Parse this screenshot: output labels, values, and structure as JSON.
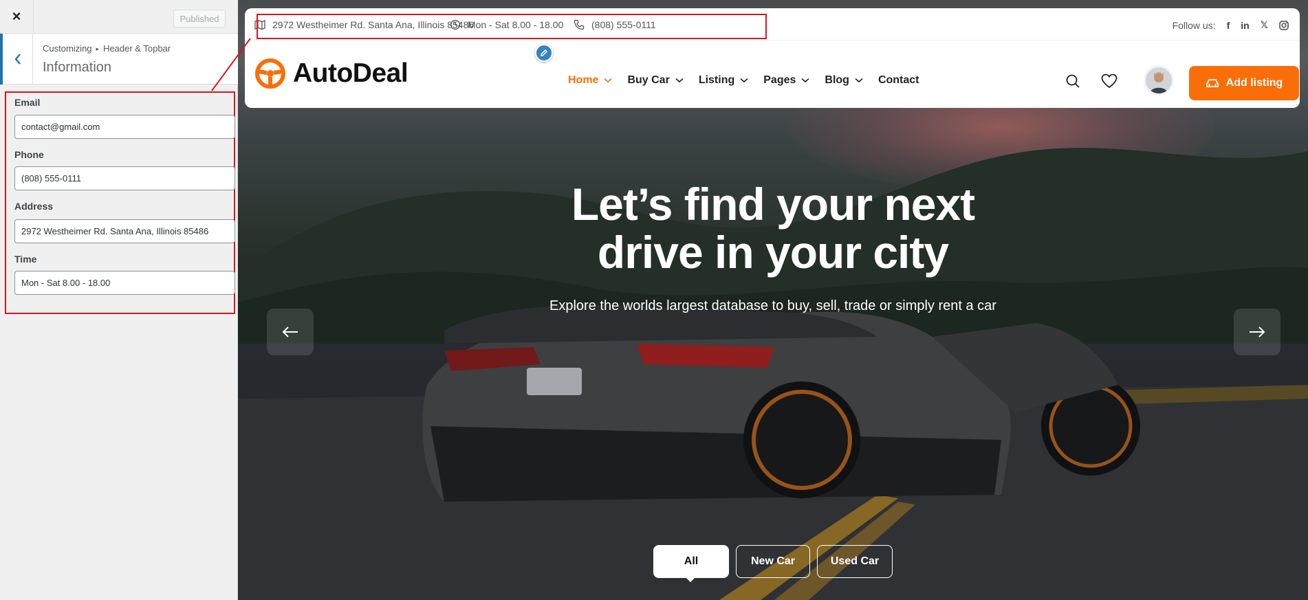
{
  "customizer": {
    "close_label": "×",
    "publish_label": "Published",
    "breadcrumb_root": "Customizing",
    "breadcrumb_sep": "▸",
    "breadcrumb_section": "Header & Topbar",
    "section_title": "Information",
    "fields": {
      "email": {
        "label": "Email",
        "value": "contact@gmail.com"
      },
      "phone": {
        "label": "Phone",
        "value": "(808) 555-0111"
      },
      "address": {
        "label": "Address",
        "value": "2972 Westheimer Rd. Santa Ana, Illinois 85486"
      },
      "time": {
        "label": "Time",
        "value": "Mon - Sat 8.00 - 18.00"
      }
    }
  },
  "site": {
    "topbar": {
      "address": "2972 Westheimer Rd. Santa Ana, Illinois 85486",
      "hours": "Mon - Sat 8.00 - 18.00",
      "phone": "(808) 555-0111",
      "follow_label": "Follow us:",
      "social": {
        "facebook": "f",
        "linkedin": "in",
        "x": "𝕏"
      }
    },
    "logo_text": "AutoDeal",
    "nav": [
      "Home",
      "Buy Car",
      "Listing",
      "Pages",
      "Blog",
      "Contact"
    ],
    "add_listing_label": "Add listing",
    "hero": {
      "title_line1": "Let’s find your next",
      "title_line2": "drive in your city",
      "subtitle": "Explore the worlds largest database to buy, sell, trade or simply rent a car"
    },
    "tabs": [
      "All",
      "New Car",
      "Used Car"
    ],
    "colors": {
      "accent": "#fa6e09",
      "highlight_box": "#d9151f",
      "wp_blue": "#2271b1"
    },
    "icons": [
      "map-icon",
      "clock-icon",
      "phone-icon",
      "facebook-icon",
      "linkedin-icon",
      "x-icon",
      "instagram-icon",
      "search-icon",
      "heart-icon",
      "car-icon",
      "arrow-left-icon",
      "arrow-right-icon",
      "pencil-icon",
      "chevron-left-icon"
    ]
  }
}
